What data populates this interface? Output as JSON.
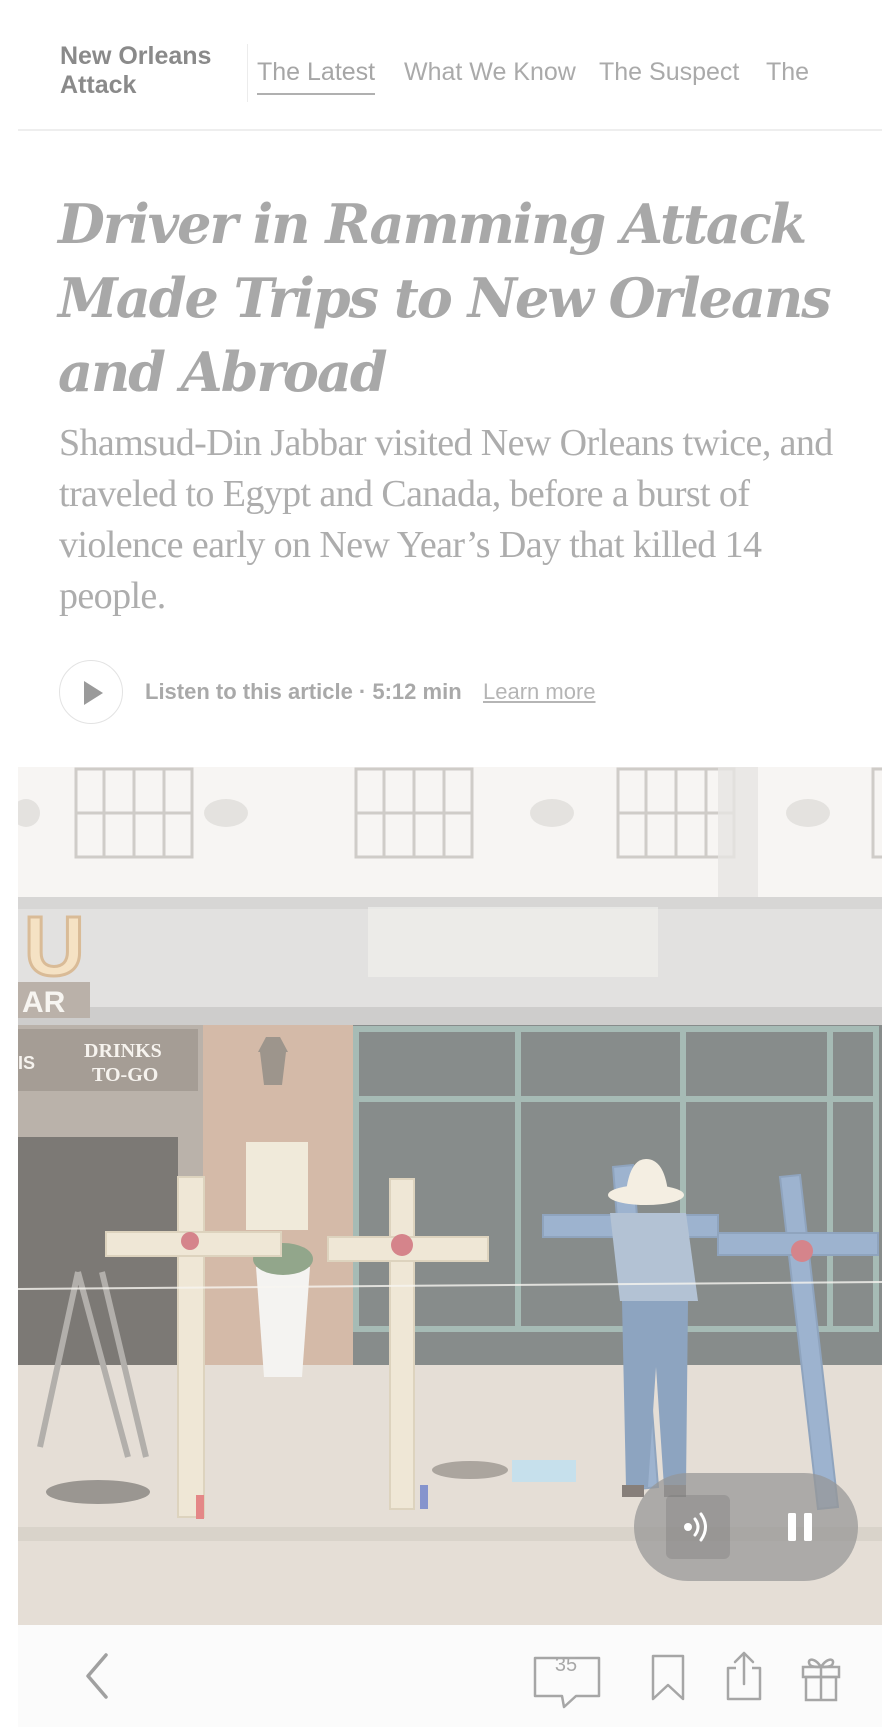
{
  "section": {
    "title": "New Orleans Attack",
    "tabs": [
      {
        "label": "The Latest",
        "active": true
      },
      {
        "label": "What We Know",
        "active": false
      },
      {
        "label": "The Suspect",
        "active": false
      },
      {
        "label": "The",
        "active": false
      }
    ]
  },
  "article": {
    "headline": "Driver in Ramming Attack Made Trips to New Orleans and Abroad",
    "summary": "Shamsud-Din Jabbar visited New Orleans twice, and traveled to Egypt and Canada, before a burst of violence early on New Year’s Day that killed 14 people."
  },
  "audio": {
    "listen_label": "Listen to this article · 5:12 min",
    "learn_more": "Learn more",
    "photo_text": {
      "drinks_sign_line1": "DRINKS",
      "drinks_sign_line2": "TO-GO",
      "bar_sign": "AR",
      "marquee_letter": "U",
      "edge_sign": "IS"
    }
  },
  "toolbar": {
    "comments_count": "35"
  },
  "icons": {
    "play": "play-icon",
    "speed": "playback-speed-icon",
    "pause": "pause-icon",
    "back": "chevron-left-icon",
    "comments": "comment-bubble-icon",
    "bookmark": "bookmark-icon",
    "share": "share-icon",
    "gift": "gift-icon"
  },
  "colors": {
    "text_muted": "#a8a8a8",
    "nav_border": "#eeeeee",
    "pill_bg": "#969696",
    "toolbar_bg": "#fbfbfb"
  }
}
